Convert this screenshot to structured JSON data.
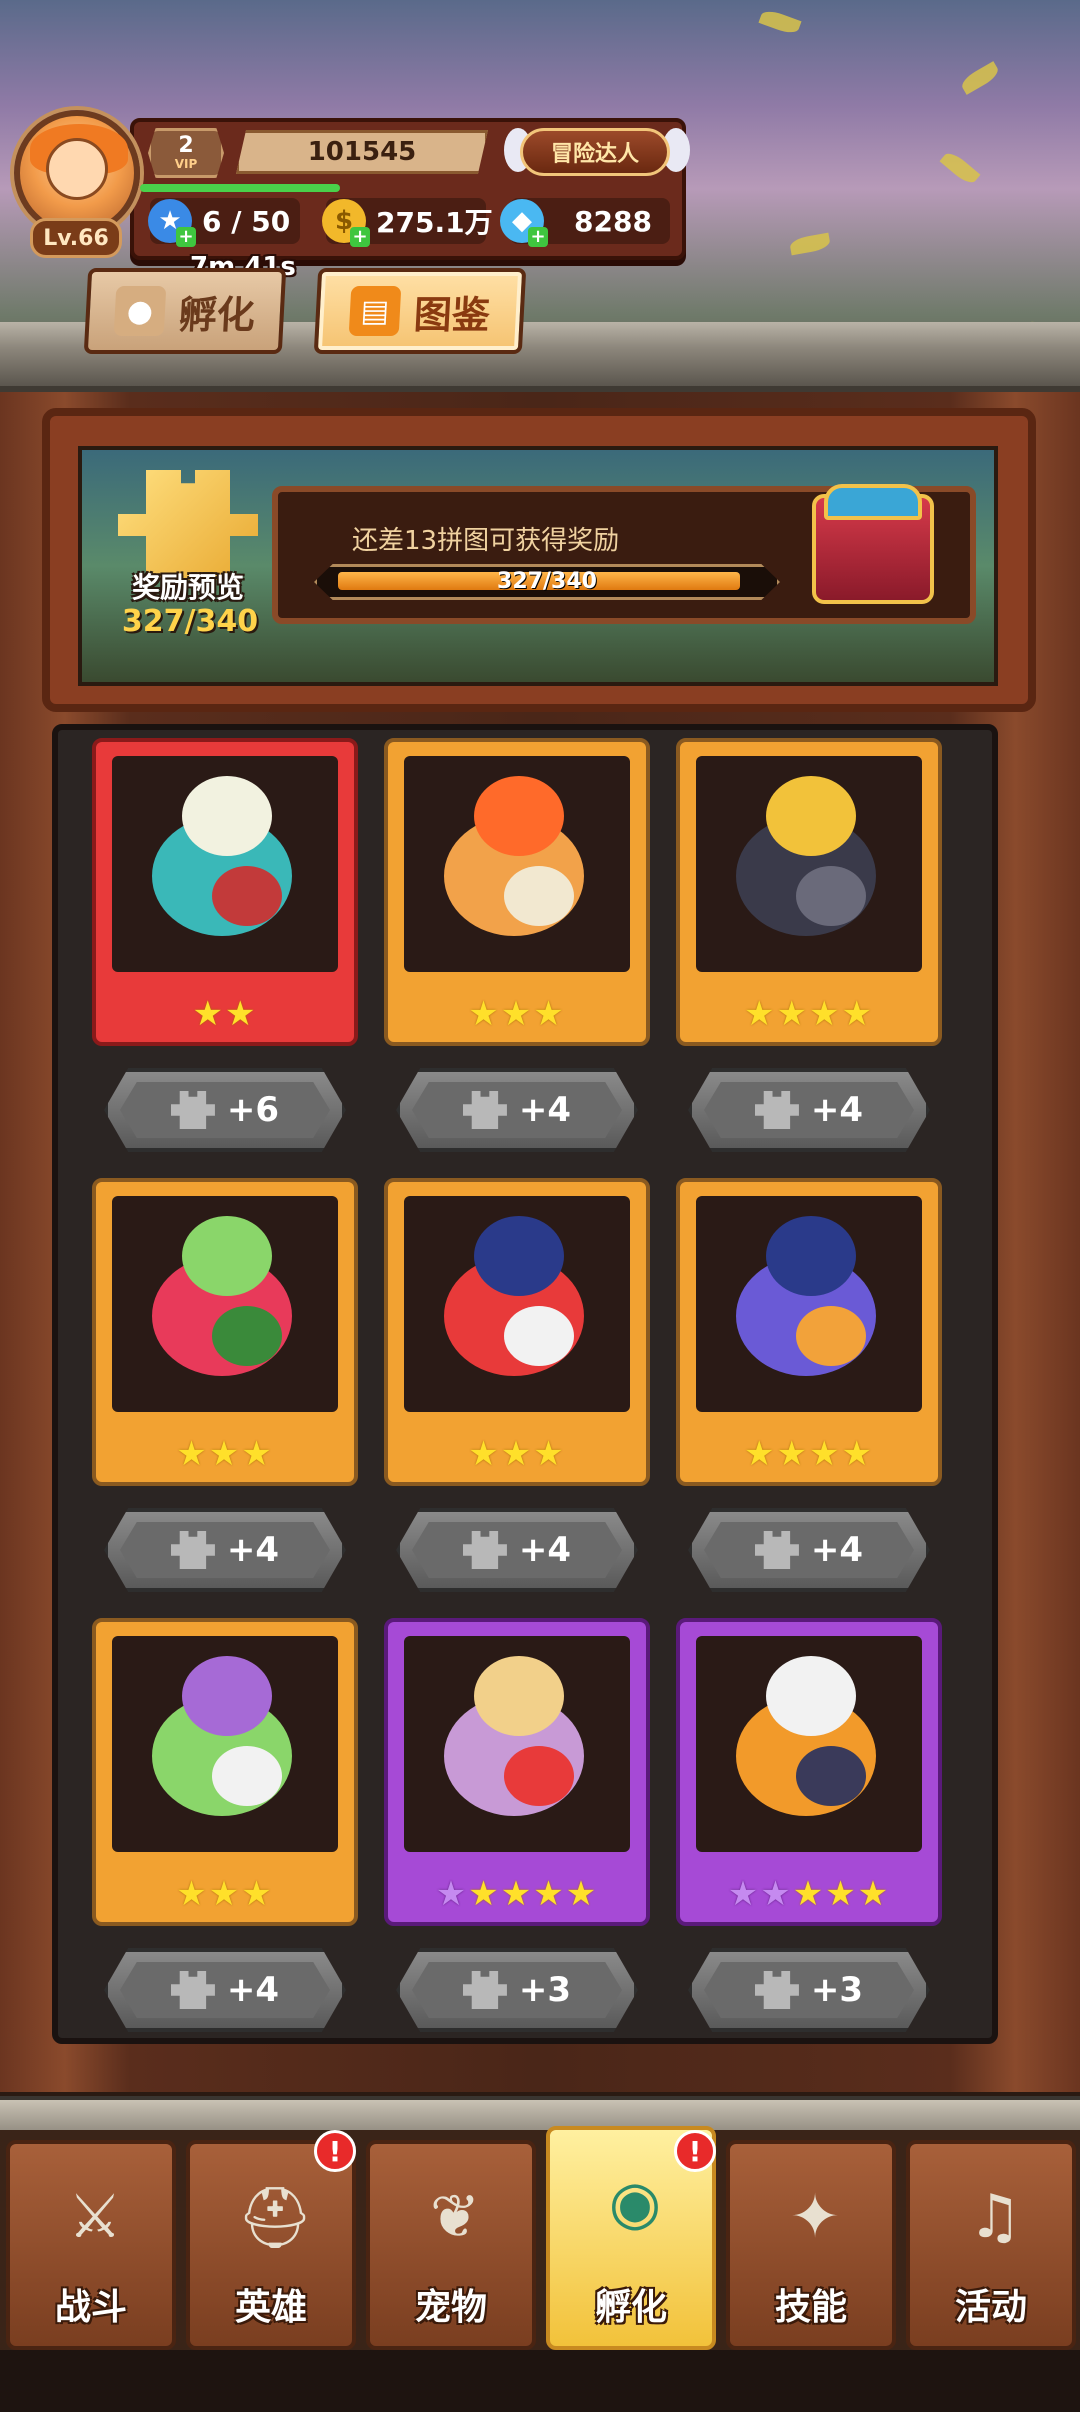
{
  "header": {
    "avatar_level": "Lv.66",
    "vip_level": "2",
    "vip_label": "VIP",
    "score": "101545",
    "title_badge": "冒险达人",
    "energy": "6 / 50",
    "gold": "275.1万",
    "gems": "8288",
    "timer": "7m 41s"
  },
  "tabs": [
    {
      "label": "孵化",
      "icon": "egg-icon"
    },
    {
      "label": "图鉴",
      "icon": "book-icon"
    }
  ],
  "reward": {
    "label": "奖励预览",
    "count": "327/340",
    "message": "还差13拼图可获得奖励",
    "progress_text": "327/340",
    "progress_fraction": 0.9618
  },
  "pets": [
    {
      "rarity": "red",
      "stars": 2,
      "purple_stars": 0,
      "pieces": "+6"
    },
    {
      "rarity": "gold",
      "stars": 3,
      "purple_stars": 0,
      "pieces": "+4"
    },
    {
      "rarity": "gold",
      "stars": 4,
      "purple_stars": 0,
      "pieces": "+4"
    },
    {
      "rarity": "gold",
      "stars": 3,
      "purple_stars": 0,
      "pieces": "+4"
    },
    {
      "rarity": "gold",
      "stars": 3,
      "purple_stars": 0,
      "pieces": "+4"
    },
    {
      "rarity": "gold",
      "stars": 4,
      "purple_stars": 0,
      "pieces": "+4"
    },
    {
      "rarity": "gold",
      "stars": 3,
      "purple_stars": 0,
      "pieces": "+4"
    },
    {
      "rarity": "purple",
      "stars": 4,
      "purple_stars": 1,
      "pieces": "+3"
    },
    {
      "rarity": "purple",
      "stars": 3,
      "purple_stars": 2,
      "pieces": "+3"
    }
  ],
  "nav": [
    {
      "label": "战斗",
      "icon": "crossed-swords-icon",
      "alert": false,
      "active": false
    },
    {
      "label": "英雄",
      "icon": "helmet-icon",
      "alert": true,
      "active": false
    },
    {
      "label": "宠物",
      "icon": "wings-icon",
      "alert": false,
      "active": false
    },
    {
      "label": "孵化",
      "icon": "egg-icon",
      "alert": true,
      "active": true
    },
    {
      "label": "技能",
      "icon": "spellbook-icon",
      "alert": false,
      "active": false
    },
    {
      "label": "活动",
      "icon": "horn-icon",
      "alert": false,
      "active": false
    }
  ],
  "alert_symbol": "!",
  "colors": {
    "accent_gold": "#f2a232",
    "rarity_red": "#e83a3a",
    "rarity_purple": "#a64ad6",
    "progress_fill": "#e07a10"
  }
}
